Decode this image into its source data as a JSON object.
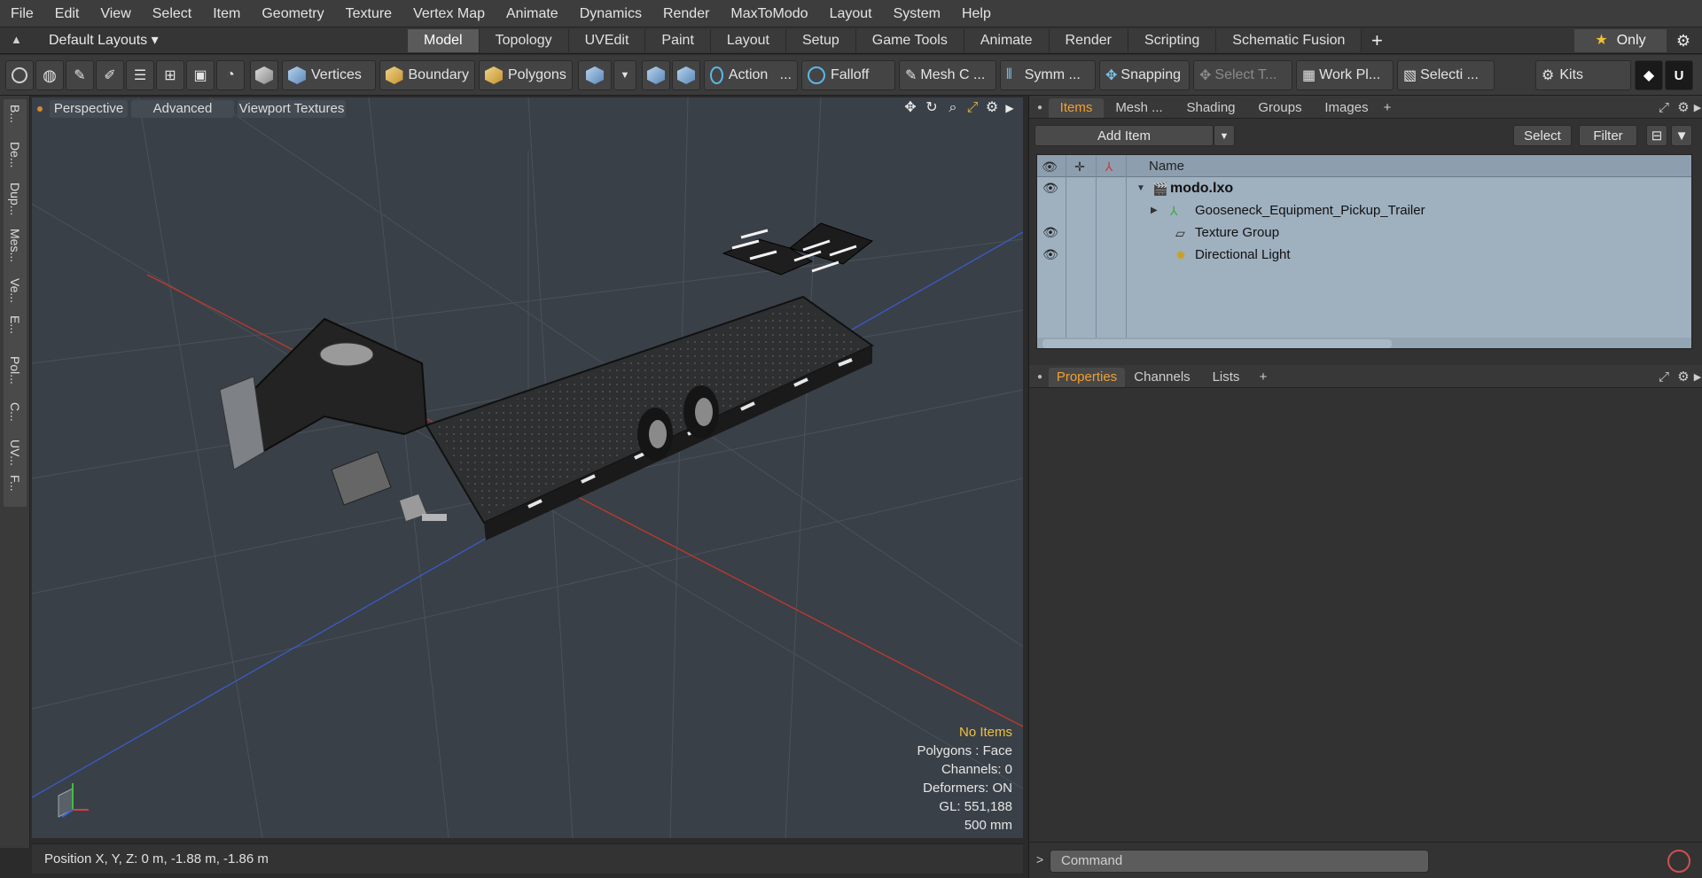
{
  "menu": [
    "File",
    "Edit",
    "View",
    "Select",
    "Item",
    "Geometry",
    "Texture",
    "Vertex Map",
    "Animate",
    "Dynamics",
    "Render",
    "MaxToModo",
    "Layout",
    "System",
    "Help"
  ],
  "layout": {
    "selector": "Default Layouts",
    "tabs": [
      "Model",
      "Topology",
      "UVEdit",
      "Paint",
      "Layout",
      "Setup",
      "Game Tools",
      "Animate",
      "Render",
      "Scripting",
      "Schematic Fusion"
    ],
    "active_tab": "Model",
    "only_label": "Only"
  },
  "toolbar": {
    "vertices": "Vertices",
    "boundary": "Boundary",
    "polygons": "Polygons",
    "action": "Action",
    "action_more": "...",
    "falloff": "Falloff",
    "mesh": "Mesh C ...",
    "symm": "Symm ...",
    "snapping": "Snapping",
    "select_t": "Select T...",
    "work_plane": "Work Pl...",
    "selection": "Selecti ...",
    "kits": "Kits"
  },
  "left_tabs": [
    "B...",
    "De...",
    "Dup...",
    "Mes...",
    "Ve...",
    "E...",
    "Pol...",
    "C...",
    "UV...",
    "F..."
  ],
  "viewport": {
    "view_mode": "Perspective",
    "shading": "Advanced",
    "textures": "Viewport Textures",
    "info": {
      "selection": "No Items",
      "polygons": "Polygons : Face",
      "channels": "Channels: 0",
      "deformers": "Deformers: ON",
      "gl": "GL: 551,188",
      "grid": "500 mm"
    }
  },
  "status": {
    "position": "Position X, Y, Z:   0 m, -1.88 m, -1.86 m"
  },
  "items_panel": {
    "tabs": [
      "Items",
      "Mesh ...",
      "Shading",
      "Groups",
      "Images"
    ],
    "active_tab": "Items",
    "add_item": "Add Item",
    "select": "Select",
    "filter": "Filter",
    "column_name": "Name",
    "rows": [
      {
        "label": "modo.lxo",
        "visible": true
      },
      {
        "label": "Gooseneck_Equipment_Pickup_Trailer",
        "visible": false
      },
      {
        "label": "Texture Group",
        "visible": true
      },
      {
        "label": "Directional Light",
        "visible": true
      }
    ]
  },
  "properties_panel": {
    "tabs": [
      "Properties",
      "Channels",
      "Lists"
    ],
    "active_tab": "Properties"
  },
  "command": {
    "placeholder": "Command"
  },
  "colors": {
    "accent": "#f0a030",
    "viewport_bg": "#3a4048",
    "axis_x": "#c0392b",
    "axis_z": "#3a5bc8",
    "list_bg": "#9fb0bf"
  }
}
